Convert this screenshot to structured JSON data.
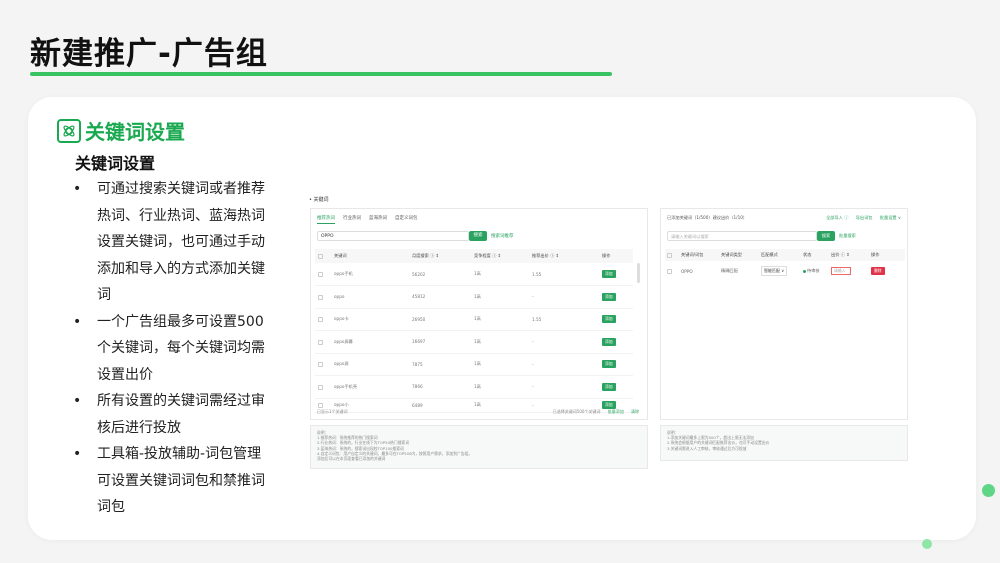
{
  "slide": {
    "title": "新建推广-广告组",
    "section_title": "关键词设置",
    "subtitle": "关键词设置",
    "bullets": [
      "可通过搜索关键词或者推荐热词、行业热词、蓝海热词设置关键词，也可通过手动添加和导入的方式添加关键词",
      "一个广告组最多可设置500个关键词，每个关键词均需设置出价",
      "所有设置的关键词需经过审核后进行投放",
      "工具箱-投放辅助-词包管理可设置关键词词包和禁推词词包"
    ]
  },
  "screenshot": {
    "header_label": "• 关键词",
    "left": {
      "tabs": [
        "推荐热词",
        "行业热词",
        "蓝海热词",
        "自定义词包"
      ],
      "search_value": "OPPO",
      "search_button": "搜索",
      "search_link": "搜索词推荐",
      "columns": [
        "关键词",
        "月度搜索 ⓘ ⇕",
        "竞争程度 ⓘ ⇕",
        "推荐出价 ⓘ ⇕",
        "操作"
      ],
      "rows": [
        {
          "kw": "oppo手机",
          "search": "56202",
          "comp": "1高",
          "bid": "1.55",
          "op": "添加"
        },
        {
          "kw": "oppo",
          "search": "45812",
          "comp": "1高",
          "bid": "-",
          "op": "添加"
        },
        {
          "kw": "oppo卡",
          "search": "26950",
          "comp": "1高",
          "bid": "1.55",
          "op": "添加"
        },
        {
          "kw": "oppo屏幕",
          "search": "16697",
          "comp": "1高",
          "bid": "-",
          "op": "添加"
        },
        {
          "kw": "oppo屏",
          "search": "7875",
          "comp": "1高",
          "bid": "-",
          "op": "添加"
        },
        {
          "kw": "oppo手机壳",
          "search": "7866",
          "comp": "1高",
          "bid": "-",
          "op": "添加"
        },
        {
          "kw": "oppo小",
          "search": "6489",
          "comp": "1高",
          "bid": "-",
          "op": "添加"
        }
      ],
      "footer_left": "已显示1个关键词",
      "footer_right": [
        "已选择关键词500个关键词",
        "批量添加",
        "清除"
      ]
    },
    "right": {
      "title": "已添加关键词（1/500）建议出价（1/10）",
      "actions": [
        "全部导入 ⓘ",
        "导出词包",
        "批量设置 ∨"
      ],
      "search_placeholder": "请输入关键词以搜索",
      "search_button": "搜索",
      "search_link": "批量搜索",
      "columns": [
        "关键词/词包",
        "关键词类型",
        "匹配模式",
        "状态",
        "出价 ⓘ ⇕",
        "操作"
      ],
      "row": {
        "kw": "OPPO",
        "type": "精确匹配",
        "mode": "智能匹配 ∨",
        "status": "待审核",
        "bid": "请输入",
        "op": "删除"
      }
    },
    "left_notes": [
      "说明：",
      "1.推荐热词：系统推荐的热门搜索词",
      "2.行业热词：系统的，行业在线下为TOP50热门搜索词",
      "3.蓝海热词：系统的，搜索词出现较TOP100搜索词",
      "4.自定义词包：用户自定义的关键词，最多可在TOP500内，按照用户需求，添加到广告组。",
      "添加后可以在本页面查看已添加的关键词"
    ],
    "right_notes": [
      "说明：",
      "1.添加关键词最多上限为500个，超出上限无法添加",
      "2.系统会根据用户的关键词匹配推荐出价，也可手动设置出价",
      "3.关键词需进入人工审核，审核通过后方可投放"
    ]
  }
}
